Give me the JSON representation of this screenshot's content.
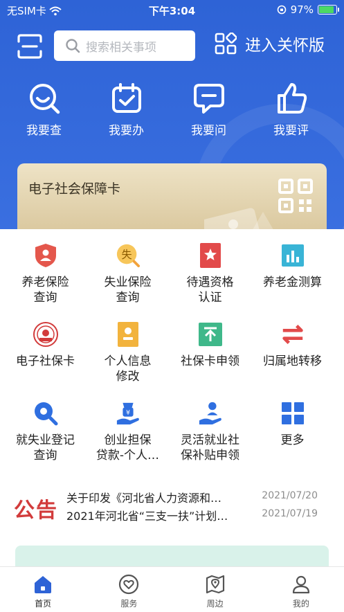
{
  "status_bar": {
    "carrier": "无SIM卡",
    "time": "下午3:04",
    "battery": "97%"
  },
  "top_bar": {
    "search_placeholder": "搜索相关事项",
    "care_mode_label": "进入关怀版"
  },
  "quick_actions": [
    {
      "label": "我要查",
      "icon": "search-smile-icon"
    },
    {
      "label": "我要办",
      "icon": "calendar-check-icon"
    },
    {
      "label": "我要问",
      "icon": "chat-bubble-icon"
    },
    {
      "label": "我要评",
      "icon": "thumbs-up-icon"
    }
  ],
  "card": {
    "title": "电子社会保障卡"
  },
  "services": [
    {
      "label": "养老保险\n查询",
      "icon": "pension-shield-icon",
      "color": "#e4574c"
    },
    {
      "label": "失业保险\n查询",
      "icon": "unemployment-icon",
      "color": "#f2b33d"
    },
    {
      "label": "待遇资格\n认证",
      "icon": "star-badge-icon",
      "color": "#e24a4a"
    },
    {
      "label": "养老金测算",
      "icon": "bar-chart-icon",
      "color": "#39b4d6"
    },
    {
      "label": "电子社保卡",
      "icon": "social-card-seal-icon",
      "color": "#d23b3b"
    },
    {
      "label": "个人信息\n修改",
      "icon": "person-card-icon",
      "color": "#f2b33d"
    },
    {
      "label": "社保卡申领",
      "icon": "upload-card-icon",
      "color": "#3fb88a"
    },
    {
      "label": "归属地转移",
      "icon": "transfer-arrows-icon",
      "color": "#e24a4a"
    },
    {
      "label": "就失业登记\n查询",
      "icon": "magnifier-icon",
      "color": "#2f6fe0"
    },
    {
      "label": "创业担保\n贷款-个人…",
      "icon": "loan-hand-icon",
      "color": "#2f6fe0"
    },
    {
      "label": "灵活就业社\n保补贴申领",
      "icon": "hand-person-icon",
      "color": "#2f6fe0"
    },
    {
      "label": "更多",
      "icon": "grid-more-icon",
      "color": "#2f6fe0"
    }
  ],
  "notice": {
    "tag": "公告",
    "items": [
      {
        "title": "关于印发《河北省人力资源和…",
        "date": "2021/07/20"
      },
      {
        "title": "2021年河北省“三支一扶”计划…",
        "date": "2021/07/19"
      }
    ]
  },
  "tabs": [
    {
      "label": "首页",
      "icon": "home-icon",
      "active": true
    },
    {
      "label": "服务",
      "icon": "heart-circle-icon",
      "active": false
    },
    {
      "label": "周边",
      "icon": "map-pin-icon",
      "active": false
    },
    {
      "label": "我的",
      "icon": "user-icon",
      "active": false
    }
  ],
  "colors": {
    "brand_blue": "#2e63d6",
    "accent_red": "#d23b3b"
  }
}
